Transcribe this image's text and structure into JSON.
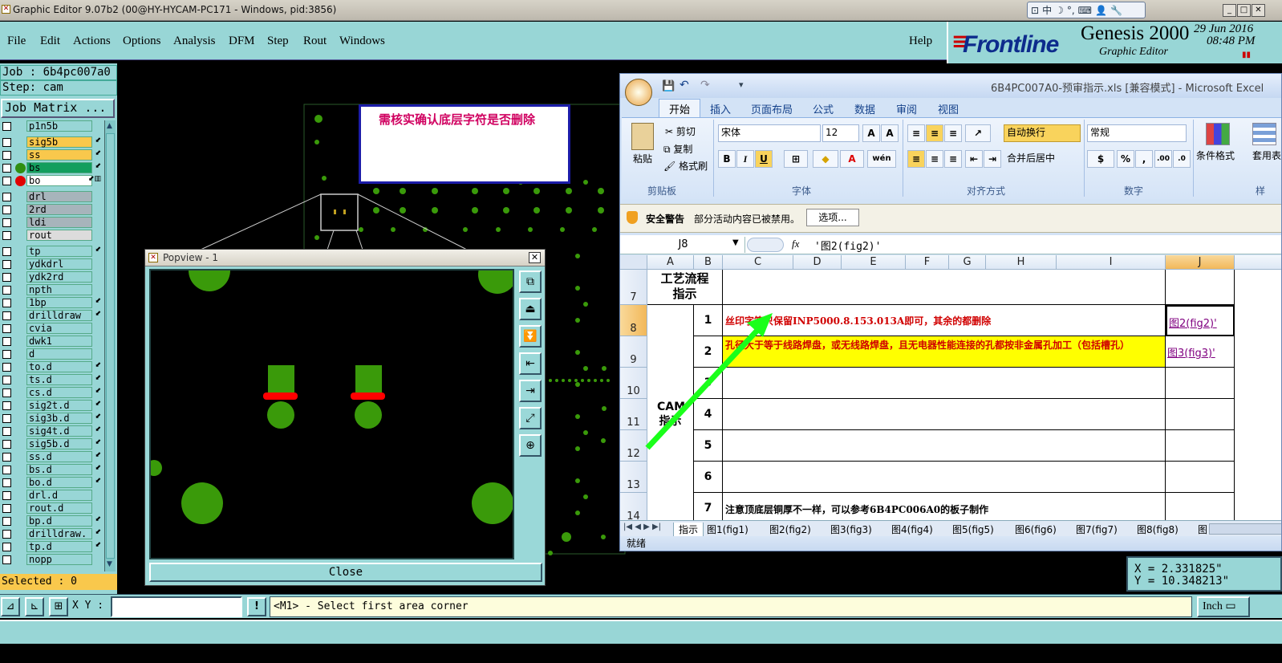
{
  "window": {
    "title": "Graphic Editor 9.07b2 (00@HY-HYCAM-PC171 - Windows, pid:3856)",
    "lang_bar": [
      "中",
      "☽",
      "°,",
      "⌨",
      "👤",
      "🔧"
    ]
  },
  "menu": {
    "items": [
      "File",
      "Edit",
      "Actions",
      "Options",
      "Analysis",
      "DFM",
      "Step",
      "Rout",
      "Windows"
    ],
    "help": "Help"
  },
  "brand": {
    "logo": "Frontline",
    "product": "Genesis 2000",
    "subtitle": "Graphic Editor",
    "date": "29 Jun 2016",
    "time": "08:48 PM"
  },
  "left_panel": {
    "job": "Job : 6b4pc007a0",
    "step": "Step: cam",
    "job_matrix": "Job Matrix ...",
    "selected": "Selected : 0",
    "layers": [
      {
        "name": "p1n5b",
        "bg": "#98d6d6",
        "dot": "",
        "flag": ""
      },
      {
        "name": "sig5b",
        "bg": "#f9c84c",
        "dot": "",
        "flag": "⬋"
      },
      {
        "name": "ss",
        "bg": "#f9c84c",
        "dot": "",
        "flag": "⬋"
      },
      {
        "name": "bs",
        "bg": "#139e5e",
        "dot": "#2f8f10",
        "flag": "⬋"
      },
      {
        "name": "bo",
        "bg": "#ffffff",
        "dot": "#e00000",
        "flag": "⬋▥"
      },
      {
        "name": "drl",
        "bg": "#a7b4bb",
        "dot": "",
        "flag": ""
      },
      {
        "name": "2rd",
        "bg": "#a7b4bb",
        "dot": "",
        "flag": ""
      },
      {
        "name": "ldi",
        "bg": "#a7b4bb",
        "dot": "",
        "flag": ""
      },
      {
        "name": "rout",
        "bg": "#dcdcdc",
        "dot": "",
        "flag": ""
      },
      {
        "name": "tp",
        "bg": "#98d6d6",
        "dot": "",
        "flag": "⬋"
      },
      {
        "name": "ydkdrl",
        "bg": "#98d6d6",
        "dot": "",
        "flag": ""
      },
      {
        "name": "ydk2rd",
        "bg": "#98d6d6",
        "dot": "",
        "flag": ""
      },
      {
        "name": "npth",
        "bg": "#98d6d6",
        "dot": "",
        "flag": ""
      },
      {
        "name": "1bp",
        "bg": "#98d6d6",
        "dot": "",
        "flag": "⬋"
      },
      {
        "name": "drilldraw",
        "bg": "#98d6d6",
        "dot": "",
        "flag": "⬋"
      },
      {
        "name": "cvia",
        "bg": "#98d6d6",
        "dot": "",
        "flag": ""
      },
      {
        "name": "dwk1",
        "bg": "#98d6d6",
        "dot": "",
        "flag": ""
      },
      {
        "name": "d",
        "bg": "#98d6d6",
        "dot": "",
        "flag": ""
      },
      {
        "name": "to.d",
        "bg": "#98d6d6",
        "dot": "",
        "flag": "⬋"
      },
      {
        "name": "ts.d",
        "bg": "#98d6d6",
        "dot": "",
        "flag": "⬋"
      },
      {
        "name": "cs.d",
        "bg": "#98d6d6",
        "dot": "",
        "flag": "⬋"
      },
      {
        "name": "sig2t.d",
        "bg": "#98d6d6",
        "dot": "",
        "flag": "⬋"
      },
      {
        "name": "sig3b.d",
        "bg": "#98d6d6",
        "dot": "",
        "flag": "⬋"
      },
      {
        "name": "sig4t.d",
        "bg": "#98d6d6",
        "dot": "",
        "flag": "⬋"
      },
      {
        "name": "sig5b.d",
        "bg": "#98d6d6",
        "dot": "",
        "flag": "⬋"
      },
      {
        "name": "ss.d",
        "bg": "#98d6d6",
        "dot": "",
        "flag": "⬋"
      },
      {
        "name": "bs.d",
        "bg": "#98d6d6",
        "dot": "",
        "flag": "⬋"
      },
      {
        "name": "bo.d",
        "bg": "#98d6d6",
        "dot": "",
        "flag": "⬋"
      },
      {
        "name": "drl.d",
        "bg": "#98d6d6",
        "dot": "",
        "flag": ""
      },
      {
        "name": "rout.d",
        "bg": "#98d6d6",
        "dot": "",
        "flag": ""
      },
      {
        "name": "bp.d",
        "bg": "#98d6d6",
        "dot": "",
        "flag": "⬋"
      },
      {
        "name": "drilldraw.",
        "bg": "#98d6d6",
        "dot": "",
        "flag": "⬋"
      },
      {
        "name": "tp.d",
        "bg": "#98d6d6",
        "dot": "",
        "flag": "⬋"
      },
      {
        "name": "nopp",
        "bg": "#98d6d6",
        "dot": "",
        "flag": ""
      }
    ]
  },
  "canvas": {
    "note": "需核实确认底层字符是否删除"
  },
  "popview": {
    "title": "Popview - 1",
    "close_label": "Close",
    "tool_icons": [
      "⧉",
      "⏏",
      "⏬",
      "⇤",
      "⇥",
      "⤢",
      "⊕"
    ]
  },
  "excel": {
    "title": "6B4PC007A0-预审指示.xls [兼容模式] - Microsoft Excel",
    "tabs": [
      "开始",
      "插入",
      "页面布局",
      "公式",
      "数据",
      "审阅",
      "视图"
    ],
    "clipboard": {
      "paste": "粘贴",
      "cut": "剪切",
      "copy": "复制",
      "format_painter": "格式刷",
      "group": "剪贴板"
    },
    "font": {
      "name": "宋体",
      "size": "12",
      "group": "字体"
    },
    "align": {
      "wrap": "自动换行",
      "merge": "合并后居中",
      "group": "对齐方式"
    },
    "number": {
      "format": "常规",
      "group": "数字"
    },
    "styles": {
      "cond": "条件格式",
      "table": "套用表格格式",
      "tail": "样"
    },
    "security": {
      "label": "安全警告",
      "message": "部分活动内容已被禁用。",
      "options": "选项..."
    },
    "formula": {
      "name_box": "J8",
      "fx": "fx",
      "value": "'图2(fig2)'"
    },
    "columns": [
      "A",
      "B",
      "C",
      "D",
      "E",
      "F",
      "G",
      "H",
      "I",
      "J"
    ],
    "rows": [
      "7",
      "8",
      "9",
      "10",
      "11",
      "12",
      "13",
      "14"
    ],
    "cells": {
      "a7": "工艺流程指示",
      "a_cam": "CAM指示",
      "b": [
        "1",
        "2",
        "3",
        "4",
        "5",
        "6",
        "7"
      ],
      "c8": "丝印字符只保留INP5000.8.153.013A即可，其余的都删除",
      "c9": "孔径大于等于线路焊盘，或无线路焊盘，且无电器性能连接的孔都按非金属孔加工（包括槽孔）",
      "c14": "注意顶底层铜厚不一样，可以参考6B4PC006A0的板子制作",
      "j8": "图2(fig2)'",
      "j9": "图3(fig3)'"
    },
    "sheet_tabs": [
      "指示",
      "图1(fig1)",
      "图2(fig2)",
      "图3(fig3)",
      "图4(fig4)",
      "图5(fig5)",
      "图6(fig6)",
      "图7(fig7)",
      "图8(fig8)",
      "图"
    ],
    "status": "就绪"
  },
  "coords": {
    "x": "X = 2.331825\"",
    "y": "Y = 10.348213\""
  },
  "bottom": {
    "xy_label": "X Y :",
    "xy_value": "",
    "prompt": "<M1> - Select first area corner",
    "units": "Inch"
  },
  "colors": {
    "panel": "#98d6d6",
    "pad_green": "#3a9a0a",
    "highlight_red": "#ff0000",
    "arrow_green": "#1aff1a"
  }
}
